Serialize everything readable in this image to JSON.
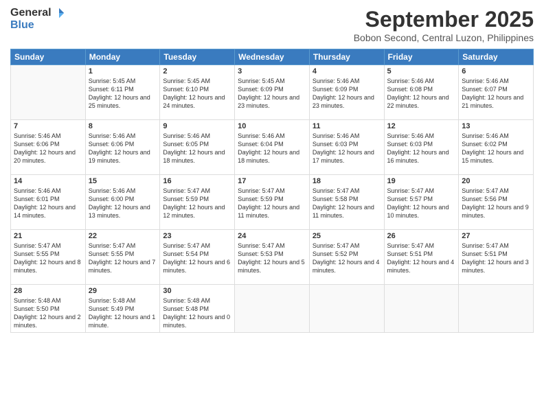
{
  "logo": {
    "general": "General",
    "blue": "Blue"
  },
  "title": {
    "month": "September 2025",
    "location": "Bobon Second, Central Luzon, Philippines"
  },
  "headers": [
    "Sunday",
    "Monday",
    "Tuesday",
    "Wednesday",
    "Thursday",
    "Friday",
    "Saturday"
  ],
  "weeks": [
    [
      {
        "day": "",
        "sunrise": "",
        "sunset": "",
        "daylight": ""
      },
      {
        "day": "1",
        "sunrise": "Sunrise: 5:45 AM",
        "sunset": "Sunset: 6:11 PM",
        "daylight": "Daylight: 12 hours and 25 minutes."
      },
      {
        "day": "2",
        "sunrise": "Sunrise: 5:45 AM",
        "sunset": "Sunset: 6:10 PM",
        "daylight": "Daylight: 12 hours and 24 minutes."
      },
      {
        "day": "3",
        "sunrise": "Sunrise: 5:45 AM",
        "sunset": "Sunset: 6:09 PM",
        "daylight": "Daylight: 12 hours and 23 minutes."
      },
      {
        "day": "4",
        "sunrise": "Sunrise: 5:46 AM",
        "sunset": "Sunset: 6:09 PM",
        "daylight": "Daylight: 12 hours and 23 minutes."
      },
      {
        "day": "5",
        "sunrise": "Sunrise: 5:46 AM",
        "sunset": "Sunset: 6:08 PM",
        "daylight": "Daylight: 12 hours and 22 minutes."
      },
      {
        "day": "6",
        "sunrise": "Sunrise: 5:46 AM",
        "sunset": "Sunset: 6:07 PM",
        "daylight": "Daylight: 12 hours and 21 minutes."
      }
    ],
    [
      {
        "day": "7",
        "sunrise": "Sunrise: 5:46 AM",
        "sunset": "Sunset: 6:06 PM",
        "daylight": "Daylight: 12 hours and 20 minutes."
      },
      {
        "day": "8",
        "sunrise": "Sunrise: 5:46 AM",
        "sunset": "Sunset: 6:06 PM",
        "daylight": "Daylight: 12 hours and 19 minutes."
      },
      {
        "day": "9",
        "sunrise": "Sunrise: 5:46 AM",
        "sunset": "Sunset: 6:05 PM",
        "daylight": "Daylight: 12 hours and 18 minutes."
      },
      {
        "day": "10",
        "sunrise": "Sunrise: 5:46 AM",
        "sunset": "Sunset: 6:04 PM",
        "daylight": "Daylight: 12 hours and 18 minutes."
      },
      {
        "day": "11",
        "sunrise": "Sunrise: 5:46 AM",
        "sunset": "Sunset: 6:03 PM",
        "daylight": "Daylight: 12 hours and 17 minutes."
      },
      {
        "day": "12",
        "sunrise": "Sunrise: 5:46 AM",
        "sunset": "Sunset: 6:03 PM",
        "daylight": "Daylight: 12 hours and 16 minutes."
      },
      {
        "day": "13",
        "sunrise": "Sunrise: 5:46 AM",
        "sunset": "Sunset: 6:02 PM",
        "daylight": "Daylight: 12 hours and 15 minutes."
      }
    ],
    [
      {
        "day": "14",
        "sunrise": "Sunrise: 5:46 AM",
        "sunset": "Sunset: 6:01 PM",
        "daylight": "Daylight: 12 hours and 14 minutes."
      },
      {
        "day": "15",
        "sunrise": "Sunrise: 5:46 AM",
        "sunset": "Sunset: 6:00 PM",
        "daylight": "Daylight: 12 hours and 13 minutes."
      },
      {
        "day": "16",
        "sunrise": "Sunrise: 5:47 AM",
        "sunset": "Sunset: 5:59 PM",
        "daylight": "Daylight: 12 hours and 12 minutes."
      },
      {
        "day": "17",
        "sunrise": "Sunrise: 5:47 AM",
        "sunset": "Sunset: 5:59 PM",
        "daylight": "Daylight: 12 hours and 11 minutes."
      },
      {
        "day": "18",
        "sunrise": "Sunrise: 5:47 AM",
        "sunset": "Sunset: 5:58 PM",
        "daylight": "Daylight: 12 hours and 11 minutes."
      },
      {
        "day": "19",
        "sunrise": "Sunrise: 5:47 AM",
        "sunset": "Sunset: 5:57 PM",
        "daylight": "Daylight: 12 hours and 10 minutes."
      },
      {
        "day": "20",
        "sunrise": "Sunrise: 5:47 AM",
        "sunset": "Sunset: 5:56 PM",
        "daylight": "Daylight: 12 hours and 9 minutes."
      }
    ],
    [
      {
        "day": "21",
        "sunrise": "Sunrise: 5:47 AM",
        "sunset": "Sunset: 5:55 PM",
        "daylight": "Daylight: 12 hours and 8 minutes."
      },
      {
        "day": "22",
        "sunrise": "Sunrise: 5:47 AM",
        "sunset": "Sunset: 5:55 PM",
        "daylight": "Daylight: 12 hours and 7 minutes."
      },
      {
        "day": "23",
        "sunrise": "Sunrise: 5:47 AM",
        "sunset": "Sunset: 5:54 PM",
        "daylight": "Daylight: 12 hours and 6 minutes."
      },
      {
        "day": "24",
        "sunrise": "Sunrise: 5:47 AM",
        "sunset": "Sunset: 5:53 PM",
        "daylight": "Daylight: 12 hours and 5 minutes."
      },
      {
        "day": "25",
        "sunrise": "Sunrise: 5:47 AM",
        "sunset": "Sunset: 5:52 PM",
        "daylight": "Daylight: 12 hours and 4 minutes."
      },
      {
        "day": "26",
        "sunrise": "Sunrise: 5:47 AM",
        "sunset": "Sunset: 5:51 PM",
        "daylight": "Daylight: 12 hours and 4 minutes."
      },
      {
        "day": "27",
        "sunrise": "Sunrise: 5:47 AM",
        "sunset": "Sunset: 5:51 PM",
        "daylight": "Daylight: 12 hours and 3 minutes."
      }
    ],
    [
      {
        "day": "28",
        "sunrise": "Sunrise: 5:48 AM",
        "sunset": "Sunset: 5:50 PM",
        "daylight": "Daylight: 12 hours and 2 minutes."
      },
      {
        "day": "29",
        "sunrise": "Sunrise: 5:48 AM",
        "sunset": "Sunset: 5:49 PM",
        "daylight": "Daylight: 12 hours and 1 minute."
      },
      {
        "day": "30",
        "sunrise": "Sunrise: 5:48 AM",
        "sunset": "Sunset: 5:48 PM",
        "daylight": "Daylight: 12 hours and 0 minutes."
      },
      {
        "day": "",
        "sunrise": "",
        "sunset": "",
        "daylight": ""
      },
      {
        "day": "",
        "sunrise": "",
        "sunset": "",
        "daylight": ""
      },
      {
        "day": "",
        "sunrise": "",
        "sunset": "",
        "daylight": ""
      },
      {
        "day": "",
        "sunrise": "",
        "sunset": "",
        "daylight": ""
      }
    ]
  ]
}
